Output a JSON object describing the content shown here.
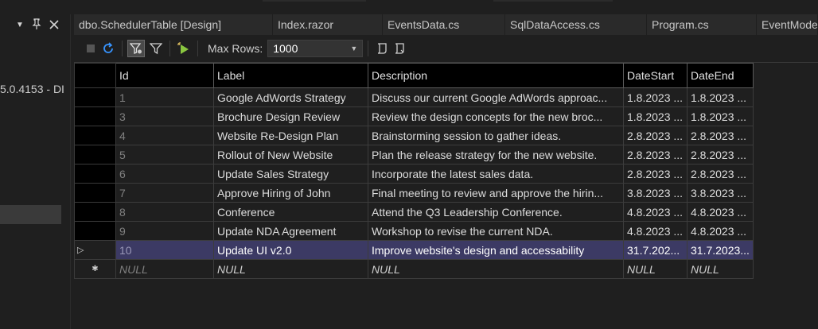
{
  "left_panel": {
    "dropdown_icon": "triangle-down-icon",
    "pin_icon": "pin-icon",
    "close_icon": "close-icon",
    "version_text": "5.0.4153 - DI"
  },
  "tabs": [
    {
      "label": "dbo.SchedulerTable [Design]"
    },
    {
      "label": "Index.razor"
    },
    {
      "label": "EventsData.cs"
    },
    {
      "label": "SqlDataAccess.cs"
    },
    {
      "label": "Program.cs"
    },
    {
      "label": "EventModel"
    }
  ],
  "toolbar": {
    "icons": [
      "stop-icon",
      "refresh-icon",
      "filter-active-icon",
      "filter-icon",
      "execute-icon"
    ],
    "max_rows_label": "Max Rows:",
    "max_rows_value": "1000",
    "script_icons": [
      "script-icon",
      "script-file-icon"
    ]
  },
  "grid": {
    "columns": [
      "Id",
      "Label",
      "Description",
      "DateStart",
      "DateEnd"
    ],
    "rows": [
      {
        "id": "1",
        "label": "Google AdWords Strategy",
        "description": "Discuss our current Google AdWords approac...",
        "date_start": "1.8.2023 ...",
        "date_end": "1.8.2023 ..."
      },
      {
        "id": "3",
        "label": "Brochure Design Review",
        "description": "Review the design concepts for the new broc...",
        "date_start": "1.8.2023 ...",
        "date_end": "1.8.2023 ..."
      },
      {
        "id": "4",
        "label": "Website Re-Design Plan",
        "description": "Brainstorming session to gather ideas.",
        "date_start": "2.8.2023 ...",
        "date_end": "2.8.2023 ..."
      },
      {
        "id": "5",
        "label": "Rollout of New Website",
        "description": "Plan the release strategy for the new website.",
        "date_start": "2.8.2023 ...",
        "date_end": "2.8.2023 ..."
      },
      {
        "id": "6",
        "label": "Update Sales Strategy",
        "description": "Incorporate the latest sales data.",
        "date_start": "2.8.2023 ...",
        "date_end": "2.8.2023 ..."
      },
      {
        "id": "7",
        "label": "Approve Hiring of John",
        "description": "Final meeting to review and approve the hirin...",
        "date_start": "3.8.2023 ...",
        "date_end": "3.8.2023 ..."
      },
      {
        "id": "8",
        "label": "Conference",
        "description": "Attend the Q3 Leadership Conference.",
        "date_start": "4.8.2023 ...",
        "date_end": "4.8.2023 ..."
      },
      {
        "id": "9",
        "label": "Update NDA Agreement",
        "description": "Workshop to revise the current NDA.",
        "date_start": "4.8.2023 ...",
        "date_end": "4.8.2023 ..."
      },
      {
        "id": "10",
        "label": "Update UI v2.0",
        "description": "Improve website's design and accessability",
        "date_start": "31.7.202...",
        "date_end": "31.7.2023..."
      }
    ],
    "selected_row_marker": "▷",
    "new_row": {
      "marker": "✱",
      "id": "NULL",
      "label": "NULL",
      "description": "NULL",
      "date_start": "NULL",
      "date_end": "NULL"
    }
  },
  "colors": {
    "background": "#1f1f1f",
    "header_bg": "#000000",
    "selected_row": "#3c3a64",
    "grid_line": "#3c3c3c",
    "run_icon": "#8ac640",
    "refresh_icon": "#3794ff"
  }
}
